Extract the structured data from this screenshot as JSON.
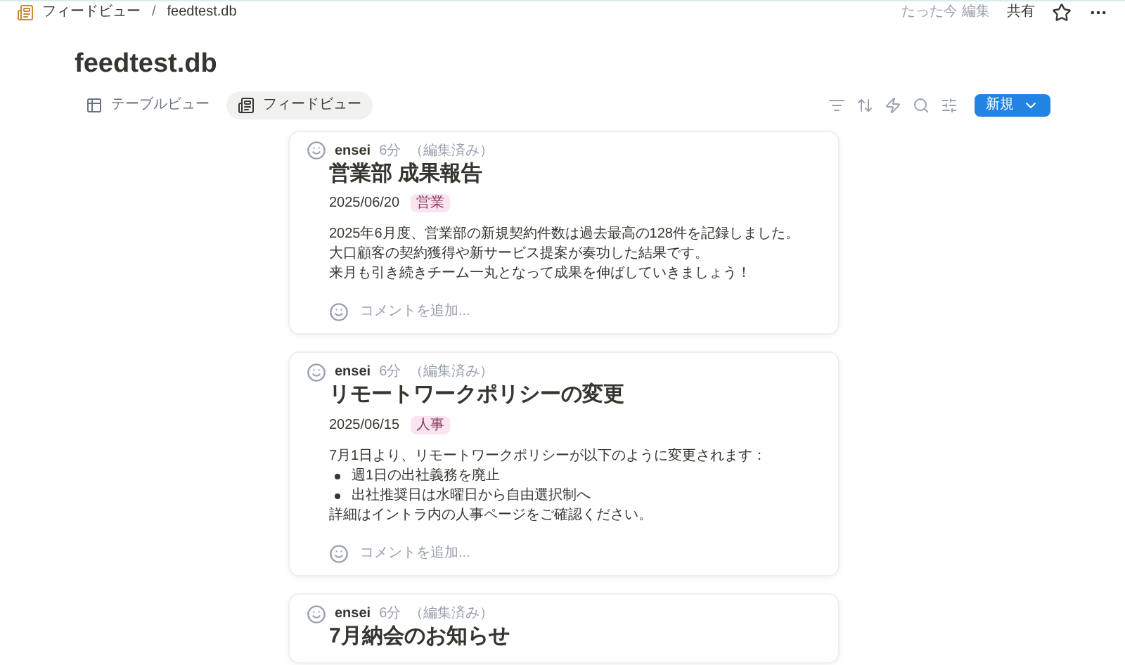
{
  "breadcrumb": [
    {
      "label": "フィードビュー"
    },
    {
      "label": "feedtest.db"
    }
  ],
  "breadcrumb_separator": "/",
  "topbar": {
    "edited": "たった今 編集",
    "share": "共有"
  },
  "title": "feedtest.db",
  "views": [
    {
      "label": "テーブルビュー",
      "kind": "table",
      "selected": false
    },
    {
      "label": "フィードビュー",
      "kind": "feed",
      "selected": true
    }
  ],
  "new_button": "新規",
  "posts": [
    {
      "author": "ensei",
      "time": "6分",
      "edited": "（編集済み）",
      "title": "営業部 成果報告",
      "date": "2025/06/20",
      "tag": "営業",
      "body": [
        {
          "kind": "text",
          "text": "2025年6月度、営業部の新規契約件数は過去最高の128件を記録しました。"
        },
        {
          "kind": "text",
          "text": "大口顧客の契約獲得や新サービス提案が奏功した結果です。"
        },
        {
          "kind": "text",
          "text": "来月も引き続きチーム一丸となって成果を伸ばしていきましょう！"
        }
      ],
      "comment_placeholder": "コメントを追加..."
    },
    {
      "author": "ensei",
      "time": "6分",
      "edited": "（編集済み）",
      "title": "リモートワークポリシーの変更",
      "date": "2025/06/15",
      "tag": "人事",
      "body": [
        {
          "kind": "text",
          "text": "7月1日より、リモートワークポリシーが以下のように変更されます："
        },
        {
          "kind": "bullet",
          "text": "週1日の出社義務を廃止"
        },
        {
          "kind": "bullet",
          "text": "出社推奨日は水曜日から自由選択制へ"
        },
        {
          "kind": "text",
          "text": "詳細はイントラ内の人事ページをご確認ください。"
        }
      ],
      "comment_placeholder": "コメントを追加..."
    },
    {
      "author": "ensei",
      "time": "6分",
      "edited": "（編集済み）",
      "title": "7月納会のお知らせ"
    }
  ]
}
